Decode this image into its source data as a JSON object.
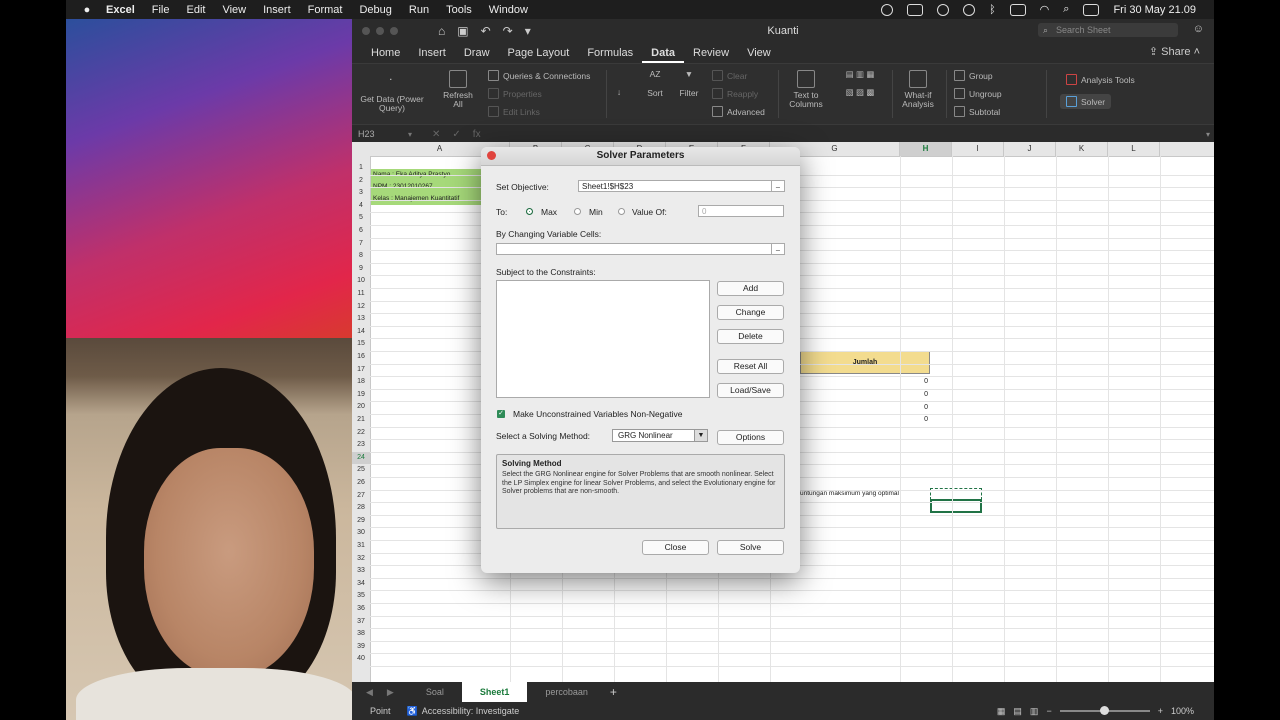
{
  "menubar": {
    "app": "Excel",
    "items": [
      "File",
      "Edit",
      "View",
      "Insert",
      "Format",
      "Debug",
      "Run",
      "Tools",
      "Window"
    ],
    "datetime": "Fri 30 May  21.09"
  },
  "window": {
    "title": "Kuanti",
    "search_placeholder": "Search Sheet",
    "share_label": "Share",
    "tabs": [
      "Home",
      "Insert",
      "Draw",
      "Page Layout",
      "Formulas",
      "Data",
      "Review",
      "View"
    ],
    "active_tab": "Data"
  },
  "ribbon": {
    "get_data": "Get Data (Power Query)",
    "refresh_all": "Refresh All",
    "queries": "Queries & Connections",
    "properties": "Properties",
    "edit_links": "Edit Links",
    "sort": "Sort",
    "filter": "Filter",
    "clear": "Clear",
    "reapply": "Reapply",
    "advanced": "Advanced",
    "text_to_columns": "Text to Columns",
    "what_if": "What-if Analysis",
    "group": "Group",
    "ungroup": "Ungroup",
    "subtotal": "Subtotal",
    "analysis_tools": "Analysis Tools",
    "solver": "Solver"
  },
  "formula_bar": {
    "name_box": "H23"
  },
  "grid": {
    "columns": [
      "A",
      "B",
      "C",
      "D",
      "E",
      "F",
      "G",
      "H",
      "I",
      "J",
      "K",
      "L"
    ],
    "rows": [
      "1",
      "2",
      "3",
      "4",
      "5",
      "6",
      "7",
      "8",
      "9",
      "10",
      "11",
      "12",
      "13",
      "14",
      "15",
      "16",
      "17",
      "18",
      "19",
      "20",
      "21",
      "22",
      "23",
      "24",
      "25",
      "26",
      "27",
      "28",
      "29",
      "30",
      "31",
      "32",
      "33",
      "34",
      "35",
      "36",
      "37",
      "38",
      "39",
      "40"
    ],
    "a1": "Nama : Eka Aditya Prastyo",
    "a2": "NPM : 23012010267",
    "a3": "Kelas : Manajemen Kuantitatif",
    "jumlah": "Jumlah",
    "zeros": [
      "0",
      "0",
      "0",
      "0"
    ],
    "f23": "untungan maksimum yang optimal"
  },
  "sheets": [
    "Soal",
    "Sheet1",
    "percobaan"
  ],
  "active_sheet": "Sheet1",
  "status": {
    "mode": "Point",
    "accessibility": "Accessibility: Investigate",
    "zoom": "100%"
  },
  "dialog": {
    "title": "Solver Parameters",
    "set_objective_label": "Set Objective:",
    "objective_value": "Sheet1!$H$23",
    "to_label": "To:",
    "max_label": "Max",
    "min_label": "Min",
    "value_of_label": "Value Of:",
    "value_of_value": "0",
    "changing_cells_label": "By Changing Variable Cells:",
    "constraints_label": "Subject to the Constraints:",
    "add": "Add",
    "change": "Change",
    "delete": "Delete",
    "reset_all": "Reset All",
    "load_save": "Load/Save",
    "nonneg_label": "Make Unconstrained Variables Non-Negative",
    "method_label": "Select a Solving Method:",
    "method_value": "GRG Nonlinear",
    "options": "Options",
    "solving_method_heading": "Solving Method",
    "solving_method_text": "Select the GRG Nonlinear engine for Solver Problems that are smooth nonlinear. Select the LP Simplex engine for linear Solver Problems, and select the Evolutionary engine for Solver problems that are non-smooth.",
    "close": "Close",
    "solve": "Solve"
  }
}
